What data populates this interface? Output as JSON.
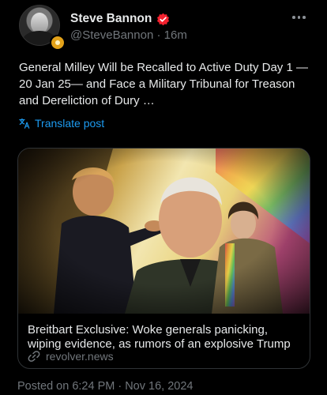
{
  "author": {
    "name": "Steve Bannon",
    "handle": "@SteveBannon",
    "time": "16m",
    "verified_color": "#f4212e"
  },
  "post": {
    "text": "General Milley Will be Recalled to Active Duty Day 1 —20 Jan 25— and Face a Military Tribunal for Treason and Dereliction of Dury …",
    "translate_label": "Translate post",
    "translate_icon": "translate-icon"
  },
  "link_card": {
    "title": "Breitbart Exclusive: Woke generals panicking, wiping evidence, as rumors of an explosive Trump",
    "domain": "revolver.news",
    "link_icon": "link-icon"
  },
  "footer": {
    "posted_on": "Posted on 6:24 PM · Nov 16, 2024"
  },
  "colors": {
    "background": "#000000",
    "text": "#e7e9ea",
    "muted": "#71767b",
    "accent": "#1d9bf0",
    "border": "#2f3336"
  }
}
